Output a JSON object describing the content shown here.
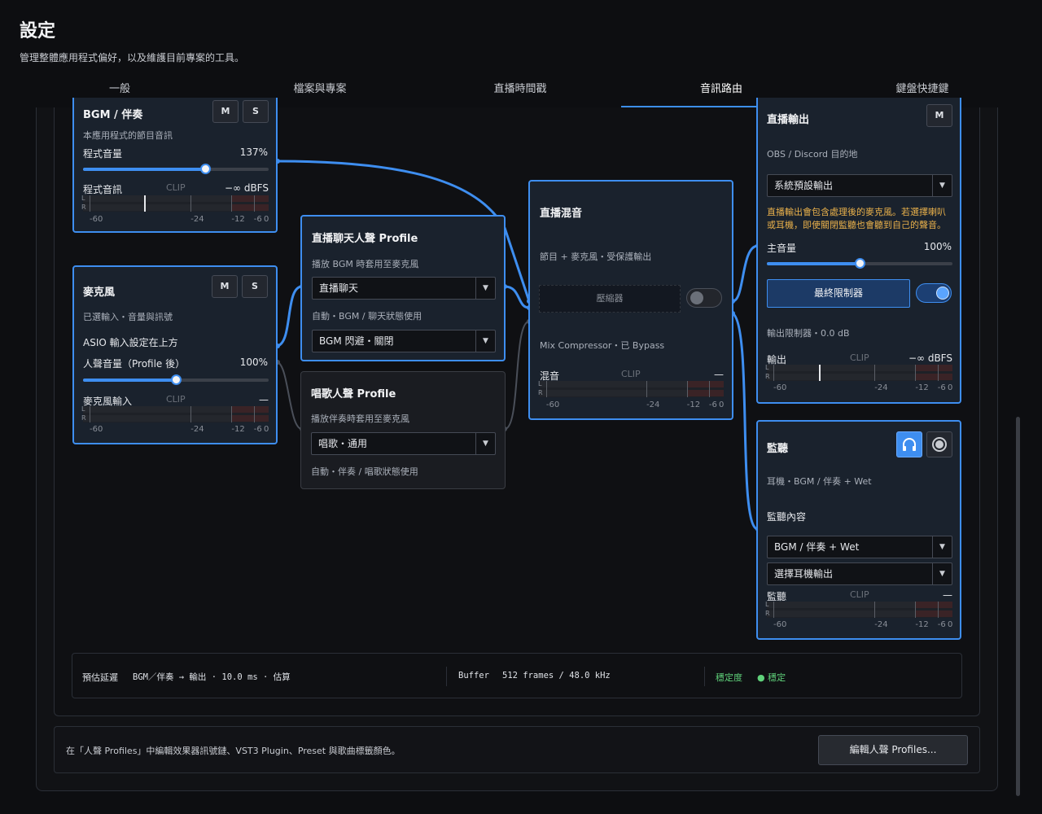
{
  "header": {
    "title": "設定",
    "subtitle": "管理整體應用程式偏好，以及維護目前專案的工具。"
  },
  "tabs": [
    {
      "label": "一般"
    },
    {
      "label": "檔案與專案"
    },
    {
      "label": "直播時間戳"
    },
    {
      "label": "音訊路由",
      "active": true
    },
    {
      "label": "鍵盤快捷鍵"
    }
  ],
  "meter_scale": [
    "-60",
    "-24",
    "-12",
    "-6",
    "0"
  ],
  "meter_channels": [
    "L",
    "R"
  ],
  "bgm": {
    "title": "BGM / 伴奏",
    "m_label": "M",
    "s_label": "S",
    "subtitle": "本應用程式的節目音訊",
    "volume_label": "程式音量",
    "volume_value": "137%",
    "volume_level": 0.66,
    "meter_label": "程式音訊",
    "clip": "CLIP",
    "meter_value": "−∞ dBFS"
  },
  "mic": {
    "title": "麥克風",
    "m_label": "M",
    "s_label": "S",
    "subtitle": "已選輸入・音量與訊號",
    "asio_note": "ASIO 輸入設定在上方",
    "volume_label": "人聲音量（Profile 後）",
    "volume_value": "100%",
    "volume_level": 0.5,
    "meter_label": "麥克風輸入",
    "clip": "CLIP",
    "meter_value": "—"
  },
  "chat_profile": {
    "title": "直播聊天人聲 Profile",
    "subtitle": "播放 BGM 時套用至麥克風",
    "select1": "直播聊天",
    "auto_note": "自動・BGM / 聊天狀態使用",
    "select2": "BGM 閃避・關閉"
  },
  "sing_profile": {
    "title": "唱歌人聲 Profile",
    "subtitle": "播放伴奏時套用至麥克風",
    "select1": "唱歌・通用",
    "auto_note": "自動・伴奏 / 唱歌狀態使用"
  },
  "mix": {
    "title": "直播混音",
    "subtitle": "節目 + 麥克風・受保護輸出",
    "compressor_label": "壓縮器",
    "compressor_status": "Mix Compressor・已 Bypass",
    "meter_label": "混音",
    "clip": "CLIP",
    "meter_value": "—"
  },
  "output": {
    "title": "直播輸出",
    "m_label": "M",
    "subtitle": "OBS / Discord 目的地",
    "select": "系統預設輸出",
    "warning": "直播輸出會包含處理後的麥克風。若選擇喇叭或耳機，即使關閉監聽也會聽到自己的聲音。",
    "volume_label": "主音量",
    "volume_value": "100%",
    "volume_level": 0.5,
    "limiter_label": "最終限制器",
    "limiter_note": "輸出限制器・0.0 dB",
    "meter_label": "輸出",
    "clip": "CLIP",
    "meter_value": "−∞ dBFS"
  },
  "monitor": {
    "title": "監聽",
    "subtitle": "耳機・BGM / 伴奏 + Wet",
    "content_label": "監聽內容",
    "select1": "BGM / 伴奏 + Wet",
    "select2": "選擇耳機輸出",
    "meter_label": "監聽",
    "clip": "CLIP",
    "meter_value": "—"
  },
  "status": {
    "latency_label": "預估延遲",
    "latency_value": "BGM／伴奏 → 輸出 · 10.0 ms · 估算",
    "buffer_label": "Buffer",
    "buffer_value": "512 frames / 48.0 kHz",
    "stability_label": "穩定度",
    "stability_value": "● 穩定"
  },
  "bottom": {
    "note": "在「人聲 Profiles」中編輯效果器訊號鏈、VST3 Plugin、Preset 與歌曲標籤顏色。",
    "button": "編輯人聲 Profiles..."
  },
  "colors": {
    "accent": "#3e8ef0",
    "warning": "#e8b04b",
    "stable": "#5fd17a"
  }
}
